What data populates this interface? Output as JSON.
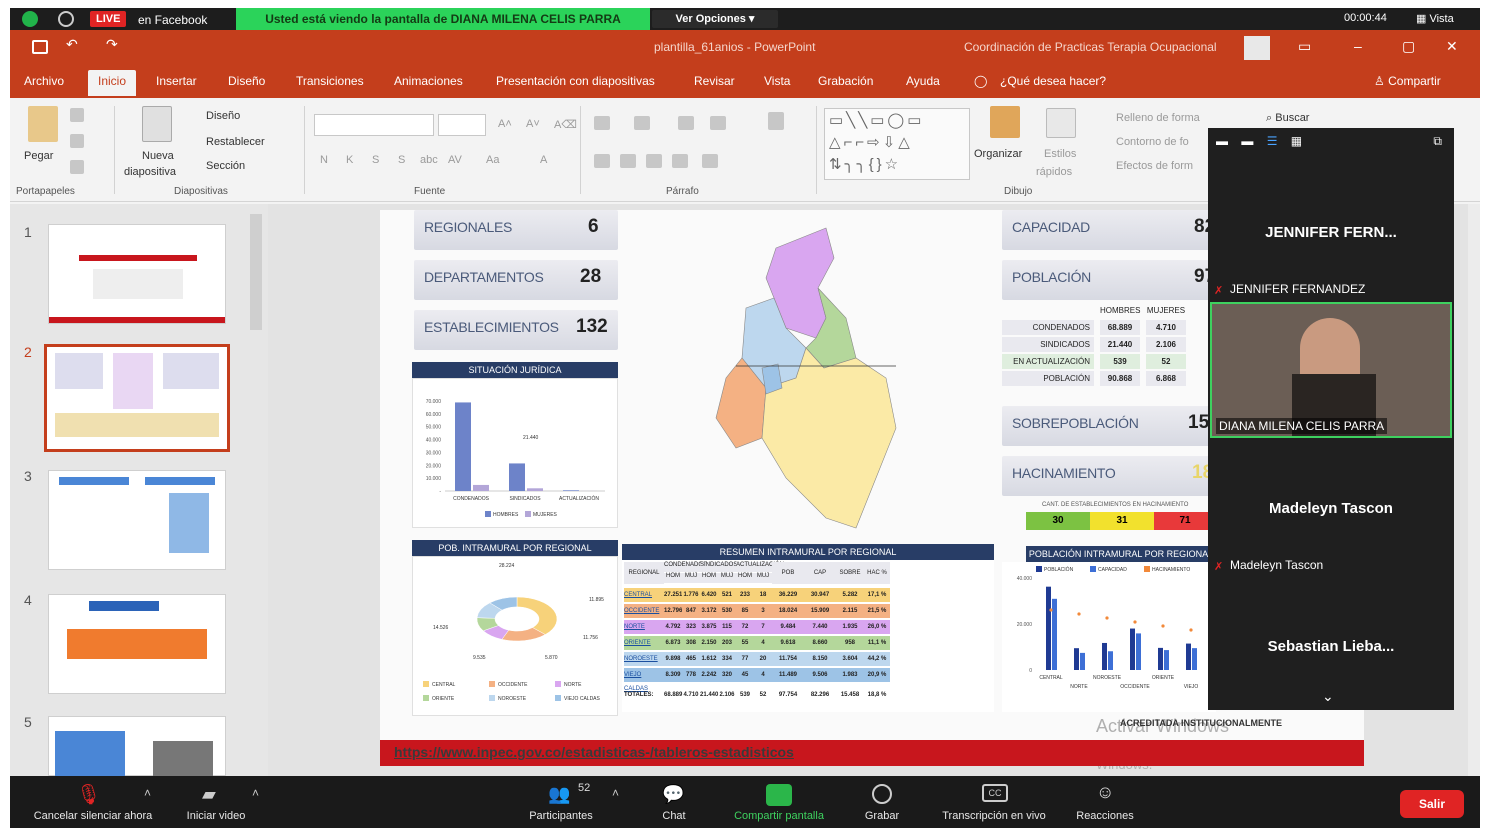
{
  "zoom_top": {
    "live": "LIVE",
    "facebook": "en Facebook",
    "banner": "Usted está viendo la pantalla de DIANA MILENA CELIS PARRA",
    "view_options": "Ver Opciones",
    "timer": "00:00:44",
    "vista": "Vista"
  },
  "ppt": {
    "document": "plantilla_61anios - PowerPoint",
    "account": "Coordinación de Practicas Terapia Ocupacional",
    "tabs": [
      "Archivo",
      "Inicio",
      "Insertar",
      "Diseño",
      "Transiciones",
      "Animaciones",
      "Presentación con diapositivas",
      "Revisar",
      "Vista",
      "Grabación",
      "Ayuda"
    ],
    "tell_me": "¿Qué desea hacer?",
    "share": "Compartir"
  },
  "ribbon": {
    "paste": "Pegar",
    "new_slide_1": "Nueva",
    "new_slide_2": "diapositiva",
    "layout": "Diseño",
    "reset": "Restablecer",
    "section": "Sección",
    "arrange": "Organizar",
    "styles_1": "Estilos",
    "styles_2": "rápidos",
    "fill": "Relleno de forma",
    "outline": "Contorno de fo",
    "effects": "Efectos de form",
    "search": "Buscar",
    "groups": [
      "Portapapeles",
      "Diapositivas",
      "Fuente",
      "Párrafo",
      "Dibujo"
    ],
    "font_buttons": [
      "N",
      "K",
      "S",
      "S",
      "abc",
      "AV",
      "Aa",
      "A"
    ]
  },
  "thumbnails": [
    "1",
    "2",
    "3",
    "4",
    "5"
  ],
  "slide": {
    "stats_left": [
      {
        "label": "REGIONALES",
        "value": "6"
      },
      {
        "label": "DEPARTAMENTOS",
        "value": "28"
      },
      {
        "label": "ESTABLECIMIENTOS",
        "value": "132"
      }
    ],
    "stats_right": [
      {
        "label": "CAPACIDAD",
        "value": "82."
      },
      {
        "label": "POBLACIÓN",
        "value": "97."
      },
      {
        "label": "SOBREPOBLACIÓN",
        "value": "15."
      },
      {
        "label": "HACINAMIENTO",
        "value": "18"
      }
    ],
    "situacion_title": "SITUACIÓN JURÍDICA",
    "sit_categories": [
      "CONDENADOS",
      "SINDICADOS",
      "ACTUALIZACIÓN"
    ],
    "sit_legend": [
      "HOMBRES",
      "MUJERES"
    ],
    "sit_label": "21.440",
    "sit_axis": [
      "70.000",
      "60.000",
      "50.000",
      "40.000",
      "30.000",
      "20.000",
      "10.000",
      "-"
    ],
    "poblacion_table": {
      "headers": [
        "HOMBRES",
        "MUJERES"
      ],
      "rows": [
        [
          "CONDENADOS",
          "68.889",
          "4.710"
        ],
        [
          "SINDICADOS",
          "21.440",
          "2.106"
        ],
        [
          "EN ACTUALIZACIÓN",
          "539",
          "52"
        ],
        [
          "POBLACIÓN",
          "90.868",
          "6.868"
        ]
      ]
    },
    "hac_title": "CANT. DE ESTABLECIMIENTOS EN HACINAMIENTO",
    "hac_values": [
      "30",
      "31",
      "71"
    ],
    "donut_title": "POB. INTRAMURAL POR REGIONAL",
    "donut_values": [
      "28.224",
      "11.895",
      "11.756",
      "9.535",
      "5.870",
      "14.526"
    ],
    "donut_legend": [
      "CENTRAL",
      "OCCIDENTE",
      "NORTE",
      "ORIENTE",
      "NOROESTE",
      "VIEJO CALDAS"
    ],
    "resumen_title": "RESUMEN INTRAMURAL POR REGIONAL",
    "resumen_headers": [
      "REGIONAL",
      "CONDENADOS",
      "SINDICADOS",
      "ACTUALIZACIÓN",
      "POB",
      "CAP",
      "SOBRE POB",
      "HAC %"
    ],
    "resumen_sub": [
      "HOM",
      "MUJ",
      "HOM",
      "MUJ",
      "HOM",
      "MUJ"
    ],
    "resumen_rows": [
      {
        "name": "CENTRAL",
        "color": "#f7d27a",
        "values": [
          "27.251",
          "1.776",
          "6.420",
          "521",
          "233",
          "18",
          "36.229",
          "30.947",
          "5.282",
          "17,1 %"
        ]
      },
      {
        "name": "OCCIDENTE",
        "color": "#f4b183",
        "values": [
          "12.796",
          "847",
          "3.172",
          "530",
          "85",
          "3",
          "18.024",
          "15.909",
          "2.115",
          "21,5 %"
        ]
      },
      {
        "name": "NORTE",
        "color": "#d9a6f0",
        "values": [
          "4.792",
          "323",
          "3.875",
          "115",
          "72",
          "7",
          "9.484",
          "7.440",
          "1.935",
          "26,0 %"
        ]
      },
      {
        "name": "ORIENTE",
        "color": "#b4d79b",
        "values": [
          "6.873",
          "308",
          "2.150",
          "203",
          "55",
          "4",
          "9.618",
          "8.660",
          "958",
          "11,1 %"
        ]
      },
      {
        "name": "NOROESTE",
        "color": "#bdd7ee",
        "values": [
          "9.898",
          "465",
          "1.612",
          "334",
          "77",
          "20",
          "11.754",
          "8.150",
          "3.604",
          "44,2 %"
        ]
      },
      {
        "name": "VIEJO CALDAS",
        "color": "#9dc3e6",
        "values": [
          "8.309",
          "778",
          "2.242",
          "320",
          "45",
          "4",
          "11.489",
          "9.506",
          "1.983",
          "20,9 %"
        ]
      }
    ],
    "resumen_total": {
      "name": "TOTALES:",
      "values": [
        "68.889",
        "4.710",
        "21.440",
        "2.106",
        "539",
        "52",
        "97.754",
        "82.296",
        "15.458",
        "18,8 %"
      ]
    },
    "barra_title": "POBLACIÓN INTRAMURAL POR REGIONAL",
    "barra_legend": [
      "POBLACIÓN",
      "CAPACIDAD",
      "HACINAMIENTO"
    ],
    "barra_axis": [
      "40.000",
      "20.000",
      "0"
    ],
    "barra_categories": [
      "CENTRAL",
      "NORTE",
      "NOROESTE",
      "OCCIDENTE",
      "ORIENTE",
      "VIEJO"
    ],
    "url": "https://www.inpec.gov.co/estadisticas-/tableros-estadisticos",
    "watermark_1": "Activar Windows",
    "watermark_2": "Ir a Configuración de PC para activar Windows.",
    "acreditada": "ACREDITADA INSTITUCIONALMENTE"
  },
  "participants": [
    {
      "name": "JENNIFER FERN...",
      "full": "JENNIFER FERNANDEZ"
    },
    {
      "name": "DIANA MILENA CELIS PARRA"
    },
    {
      "name": "Madeleyn Tascon",
      "full": "Madeleyn Tascon"
    },
    {
      "name": "Sebastian  Lieba..."
    }
  ],
  "zoom_bottom": {
    "mute": "Cancelar silenciar ahora",
    "video": "Iniciar video",
    "participants": "Participantes",
    "participants_count": "52",
    "chat": "Chat",
    "share": "Compartir pantalla",
    "record": "Grabar",
    "transcription": "Transcripción en vivo",
    "reactions": "Reacciones",
    "leave": "Salir",
    "cc": "CC"
  },
  "colors": {
    "ppt_red": "#c43e1c",
    "zoom_green": "#2bd35a",
    "zoom_dark": "#1a1a1a",
    "leave_red": "#e02424"
  },
  "chart_data": [
    {
      "type": "bar",
      "title": "SITUACIÓN JURÍDICA",
      "categories": [
        "CONDENADOS",
        "SINDICADOS",
        "ACTUALIZACIÓN"
      ],
      "series": [
        {
          "name": "HOMBRES",
          "values": [
            68889,
            21440,
            539
          ]
        },
        {
          "name": "MUJERES",
          "values": [
            4710,
            2106,
            52
          ]
        }
      ],
      "ylim": [
        0,
        70000
      ]
    },
    {
      "type": "pie",
      "title": "POB. INTRAMURAL POR REGIONAL",
      "categories": [
        "CENTRAL",
        "OCCIDENTE",
        "NORTE",
        "ORIENTE",
        "NOROESTE",
        "VIEJO CALDAS"
      ],
      "values": [
        36229,
        18024,
        9484,
        9618,
        11754,
        11489
      ]
    },
    {
      "type": "bar",
      "title": "POBLACIÓN INTRAMURAL POR REGIONAL",
      "categories": [
        "CENTRAL",
        "NORTE",
        "NOROESTE",
        "OCCIDENTE",
        "ORIENTE",
        "VIEJO"
      ],
      "series": [
        {
          "name": "POBLACIÓN",
          "values": [
            36229,
            9484,
            11754,
            18024,
            9618,
            11489
          ]
        },
        {
          "name": "CAPACIDAD",
          "values": [
            30947,
            7440,
            8150,
            15909,
            8660,
            9506
          ]
        }
      ],
      "ylim": [
        0,
        40000
      ]
    }
  ]
}
